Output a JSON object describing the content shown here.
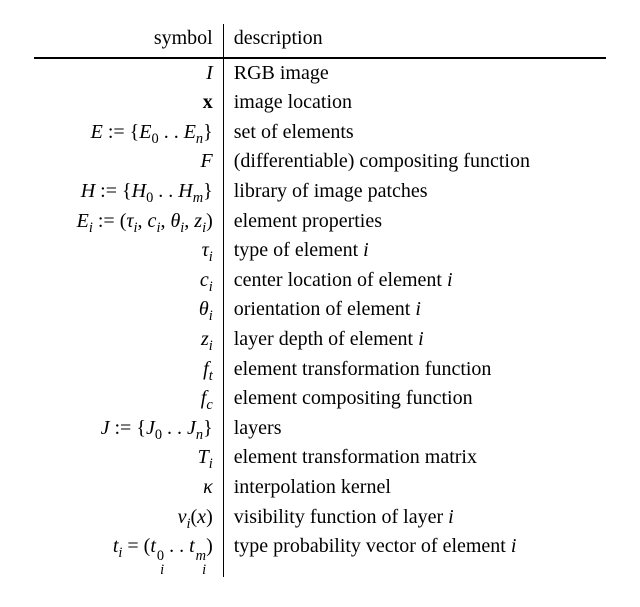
{
  "chart_data": {
    "type": "table",
    "title": "",
    "columns": [
      "symbol",
      "description"
    ],
    "rows": [
      {
        "symbol": "I",
        "description": "RGB image"
      },
      {
        "symbol": "x",
        "description": "image location"
      },
      {
        "symbol": "ℰ := {E_0 .. E_n}",
        "description": "set of elements"
      },
      {
        "symbol": "ℱ",
        "description": "(differentiable) compositing function"
      },
      {
        "symbol": "ℋ := {H_0 .. H_m}",
        "description": "library of image patches"
      },
      {
        "symbol": "E_i := (τ_i, c_i, θ_i, z_i)",
        "description": "element properties"
      },
      {
        "symbol": "τ_i",
        "description": "type of element i"
      },
      {
        "symbol": "c_i",
        "description": "center location of element i"
      },
      {
        "symbol": "θ_i",
        "description": "orientation of element i"
      },
      {
        "symbol": "z_i",
        "description": "layer depth of element i"
      },
      {
        "symbol": "f_t",
        "description": "element transformation function"
      },
      {
        "symbol": "f_c",
        "description": "element compositing function"
      },
      {
        "symbol": "𝒥 := {J_0 .. J_n}",
        "description": "layers"
      },
      {
        "symbol": "T_i",
        "description": "element transformation matrix"
      },
      {
        "symbol": "κ",
        "description": "interpolation kernel"
      },
      {
        "symbol": "v_i(x)",
        "description": "visibility function of layer i"
      },
      {
        "symbol": "t_i = (t_i^0 .. t_i^m)",
        "description": "type probability vector of element i"
      }
    ]
  },
  "header": {
    "symbol": "symbol",
    "description": "description"
  },
  "rows": {
    "r0": {
      "desc": "RGB image"
    },
    "r1": {
      "desc": "image location"
    },
    "r2": {
      "desc": "set of elements"
    },
    "r3": {
      "desc": "(differentiable) compositing function"
    },
    "r4": {
      "desc": "library of image patches"
    },
    "r5": {
      "desc": "element properties"
    },
    "r6": {
      "desc": "type of element "
    },
    "r7": {
      "desc": "center location of element "
    },
    "r8": {
      "desc": "orientation of element "
    },
    "r9": {
      "desc": "layer depth of element "
    },
    "r10": {
      "desc": "element transformation function"
    },
    "r11": {
      "desc": "element compositing function"
    },
    "r12": {
      "desc": "layers"
    },
    "r13": {
      "desc": "element transformation matrix"
    },
    "r14": {
      "desc": "interpolation kernel"
    },
    "r15": {
      "desc": "visibility function of layer "
    },
    "r16": {
      "desc": "type probability vector of element "
    }
  },
  "glyph": {
    "i": "i",
    "n": "n",
    "m": "m",
    "zero": "0",
    "I": "I",
    "x": "x",
    "E": "E",
    "F": "F",
    "H": "H",
    "J": "J",
    "Eit": "E",
    "Hit": "H",
    "Jit": "J",
    "Tit": "T",
    "tau": "τ",
    "theta": "θ",
    "kappa": "κ",
    "c": "c",
    "z": "z",
    "f": "f",
    "t": "t",
    "v": "v",
    "assign": " := ",
    "eq": " = ",
    "lb": "{",
    "rb": "}",
    "lp": "(",
    "rp": ")",
    "dots": " . . ",
    "comma": ", "
  }
}
